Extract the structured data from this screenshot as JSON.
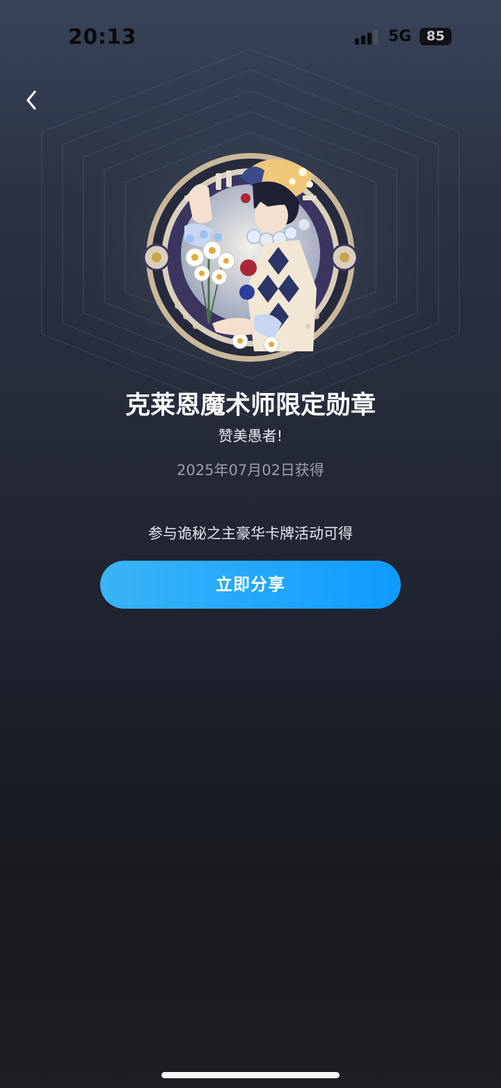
{
  "status_bar": {
    "time": "20:13",
    "network": "5G",
    "battery": "85"
  },
  "icons": {
    "back": "chevron-left-icon",
    "signal": "cellular-signal-icon",
    "battery": "battery-icon"
  },
  "badge": {
    "title": "克莱恩魔术师限定勋章",
    "subtitle": "赞美愚者!",
    "date": "2025年07月02日获得",
    "hint": "参与诡秘之主豪华卡牌活动可得"
  },
  "actions": {
    "share_label": "立即分享"
  },
  "colors": {
    "accent": "#0f9bff",
    "accent_light": "#3ab4f6",
    "title": "#ffffff",
    "muted": "#9aa0ad"
  }
}
